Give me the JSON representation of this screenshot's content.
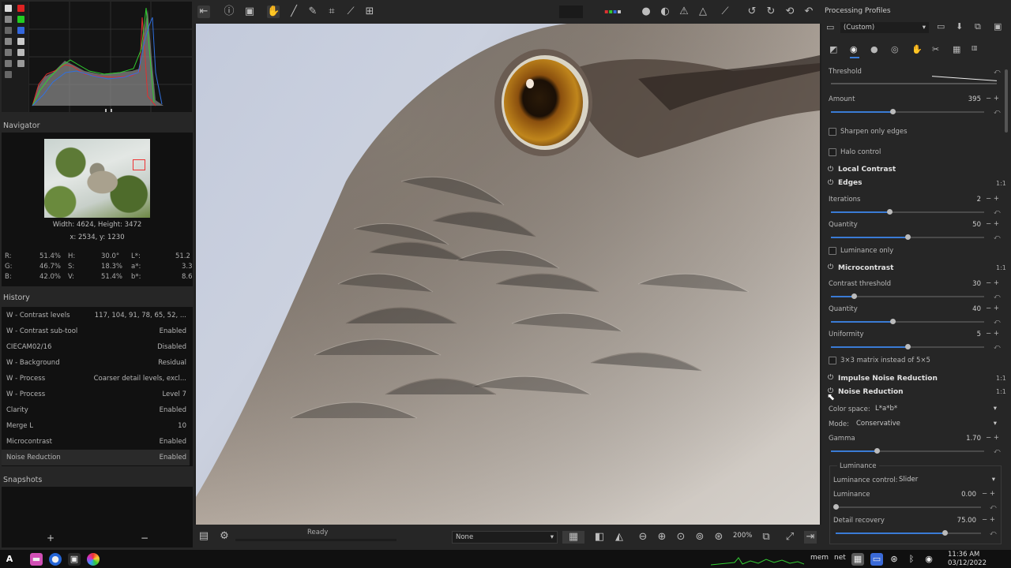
{
  "left_panel": {
    "navigator_title": "Navigator",
    "image_size": "Width: 4624, Height: 3472",
    "coords": "x: 2534, y: 1230",
    "readout": [
      {
        "c": "R:",
        "v": "51.4%",
        "h": "H:",
        "hv": "30.0°",
        "l": "L*:",
        "lv": "51.2"
      },
      {
        "c": "G:",
        "v": "46.7%",
        "h": "S:",
        "hv": "18.3%",
        "l": "a*:",
        "lv": "3.3"
      },
      {
        "c": "B:",
        "v": "42.0%",
        "h": "V:",
        "hv": "51.4%",
        "l": "b*:",
        "lv": "8.6"
      }
    ],
    "history_title": "History",
    "history": [
      {
        "label": "W - Contrast levels",
        "value": "117, 104, 91, 78, 65, 52, ..."
      },
      {
        "label": "W - Contrast sub-tool",
        "value": "Enabled"
      },
      {
        "label": "CIECAM02/16",
        "value": "Disabled"
      },
      {
        "label": "W - Background",
        "value": "Residual"
      },
      {
        "label": "W - Process",
        "value": "Coarser detail levels, excl..."
      },
      {
        "label": "W - Process",
        "value": "Level 7"
      },
      {
        "label": "Clarity",
        "value": "Enabled"
      },
      {
        "label": "Merge L",
        "value": "10"
      },
      {
        "label": "Microcontrast",
        "value": "Enabled"
      },
      {
        "label": "Noise Reduction",
        "value": "Enabled"
      }
    ],
    "snapshots_title": "Snapshots",
    "add_symbol": "+",
    "remove_symbol": "−"
  },
  "status_bar": {
    "ready": "Ready",
    "none_select": "None",
    "zoom": "200%"
  },
  "right_panel": {
    "processing_profiles": "Processing Profiles",
    "profile_value": "(Custom)",
    "threshold_label": "Threshold",
    "amount_label": "Amount",
    "amount_value": "395",
    "sharpen_edges": "Sharpen only edges",
    "halo_control": "Halo control",
    "local_contrast": "Local Contrast",
    "edges": "Edges",
    "iterations_label": "Iterations",
    "iterations_value": "2",
    "quantity_label": "Quantity",
    "quantity_value": "50",
    "luminance_only": "Luminance only",
    "microcontrast": "Microcontrast",
    "contrast_threshold_label": "Contrast threshold",
    "contrast_threshold_value": "30",
    "mc_quantity_label": "Quantity",
    "mc_quantity_value": "40",
    "uniformity_label": "Uniformity",
    "uniformity_value": "5",
    "matrix_label": "3×3 matrix instead of 5×5",
    "impulse_nr": "Impulse Noise Reduction",
    "noise_reduction": "Noise Reduction",
    "color_space_label": "Color space:",
    "color_space_value": "L*a*b*",
    "mode_label": "Mode:",
    "mode_value": "Conservative",
    "gamma_label": "Gamma",
    "gamma_value": "1.70",
    "luminance_group": "Luminance",
    "luminance_control_label": "Luminance control:",
    "luminance_control_value": "Slider",
    "luminance_label": "Luminance",
    "luminance_value": "0.00",
    "detail_recovery_label": "Detail recovery",
    "detail_recovery_value": "75.00",
    "one_to_one": "1:1"
  },
  "levels": {
    "amount": 0.4,
    "iterations": 0.38,
    "quantity": 0.5,
    "contrast_threshold": 0.15,
    "mc_quantity": 0.4,
    "uniformity": 0.5,
    "gamma": 0.3,
    "luminance": 0.0,
    "detail_recovery": 0.75
  },
  "taskbar": {
    "mem": "mem",
    "net": "net",
    "time": "11:36 AM",
    "date": "03/12/2022"
  },
  "colors": {
    "accent": "#3a7bd5",
    "panel_bg": "#262626",
    "dark_bg": "#111111"
  }
}
